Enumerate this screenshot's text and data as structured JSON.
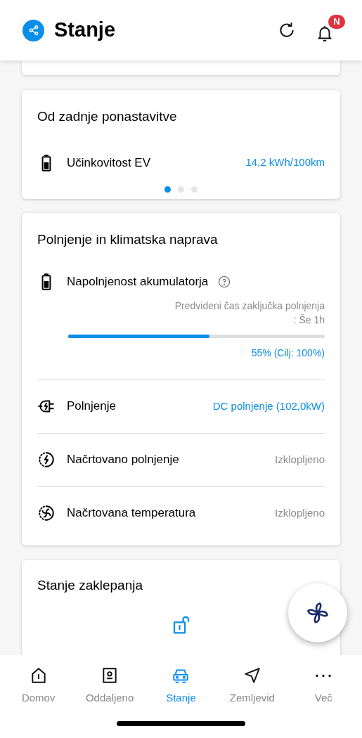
{
  "header": {
    "title": "Stanje",
    "notification_badge": "N"
  },
  "since_reset": {
    "title": "Od zadnje ponastavitve",
    "row": {
      "kind": "battery",
      "label": "Učinkovitost EV",
      "value": "14,2 kWh/100km",
      "color": "#0a8ee8"
    },
    "pager": [
      {
        "selected": true
      },
      {
        "selected": false
      },
      {
        "selected": false
      }
    ]
  },
  "charging": {
    "title": "Polnjenje in klimatska naprava",
    "battery": {
      "label": "Napolnjenost akumulatorja",
      "estimate": "Predvideni čas zaključka polnjenja\n: Še 1h",
      "level": 0.55,
      "reading": "55% (Cilj: 100%)"
    },
    "rows": [
      {
        "kind": "plug",
        "label": "Polnjenje",
        "value": "DC polnjenje (102,0kW)",
        "color": "#0a8ee8"
      },
      {
        "kind": "scheduled-charge",
        "label": "Načrtovano polnjenje",
        "value": "Izklopljeno",
        "color": "#8a8a8a"
      },
      {
        "kind": "scheduled-climate",
        "label": "Načrtovana temperatura",
        "value": "Izklopljeno",
        "color": "#8a8a8a"
      }
    ]
  },
  "lock": {
    "title": "Stanje zaklepanja"
  },
  "nav": [
    {
      "kind": "home",
      "label": "Domov",
      "selected": false
    },
    {
      "kind": "remote",
      "label": "Oddaljeno",
      "selected": false
    },
    {
      "kind": "car",
      "label": "Stanje",
      "selected": true
    },
    {
      "kind": "map",
      "label": "Zemljevid",
      "selected": false
    },
    {
      "kind": "more",
      "label": "Več",
      "selected": false
    }
  ]
}
